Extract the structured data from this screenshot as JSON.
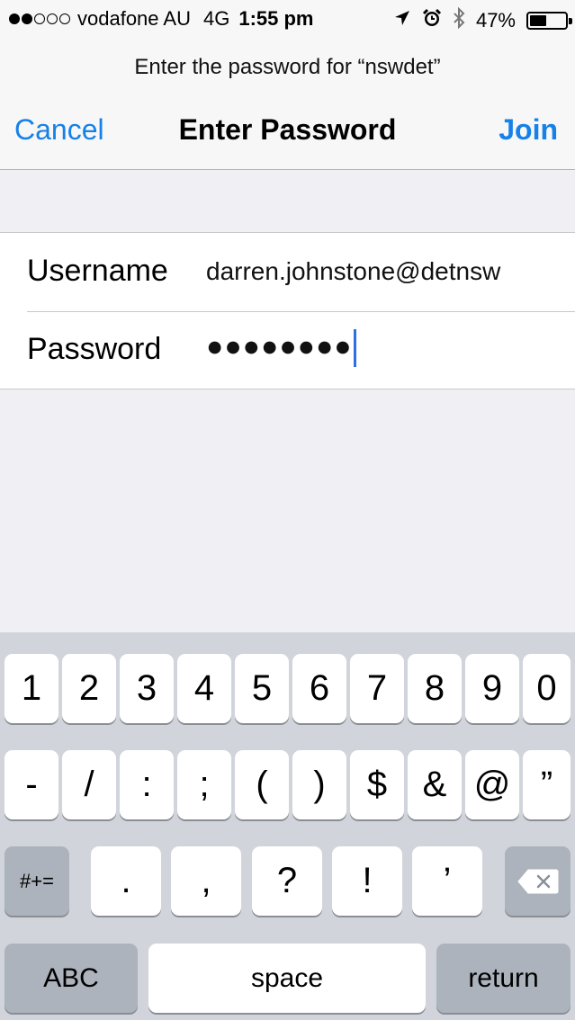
{
  "status_bar": {
    "carrier": "vodafone AU",
    "network": "4G",
    "time": "1:55 pm",
    "battery": "47%",
    "battery_level": 0.47,
    "signal_bars_full": 2,
    "signal_bars_total": 5,
    "icons": [
      "location-arrow-icon",
      "alarm-clock-icon",
      "bluetooth-icon",
      "battery-icon"
    ]
  },
  "header": {
    "prompt": "Enter the password for “nswdet”",
    "title": "Enter Password",
    "cancel_label": "Cancel",
    "join_label": "Join"
  },
  "form": {
    "username_label": "Username",
    "username_value": "darren.johnstone@detnsw",
    "password_label": "Password",
    "password_mask": "●●●●●●●●"
  },
  "keyboard": {
    "row1": [
      "1",
      "2",
      "3",
      "4",
      "5",
      "6",
      "7",
      "8",
      "9",
      "0"
    ],
    "row2": [
      "-",
      "/",
      ":",
      ";",
      "(",
      ")",
      "$",
      "&",
      "@",
      "”"
    ],
    "row3_mode": "#+=",
    "row3": [
      ".",
      ",",
      "?",
      "!",
      "’"
    ],
    "backspace_icon": "backspace-icon",
    "abc_label": "ABC",
    "space_label": "space",
    "return_label": "return"
  },
  "colors": {
    "accent": "#1681e8",
    "cursor": "#2f6fe4",
    "keyboard_bg": "#d1d5db",
    "dark_key": "#acb3bc",
    "background": "#efeff4"
  }
}
